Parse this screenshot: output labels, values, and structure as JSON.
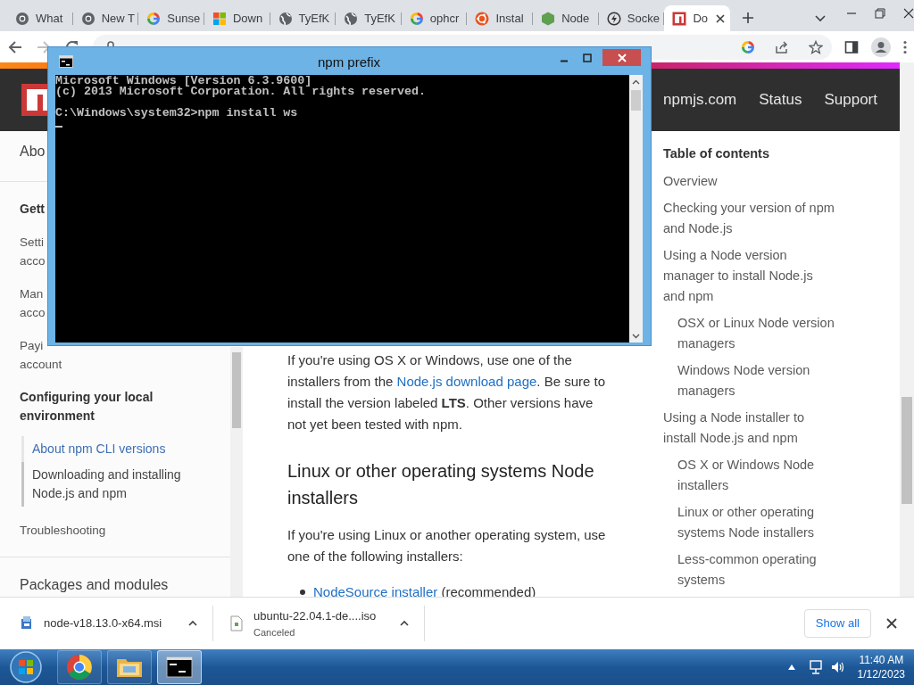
{
  "browser": {
    "tabs": [
      {
        "label": "What",
        "kind": "chrome",
        "selected": false
      },
      {
        "label": "New T",
        "kind": "chrome",
        "selected": false
      },
      {
        "label": "Sunse",
        "kind": "google",
        "selected": false
      },
      {
        "label": "Down",
        "kind": "windows",
        "selected": false
      },
      {
        "label": "TyEfK",
        "kind": "globe",
        "selected": false
      },
      {
        "label": "TyEfK",
        "kind": "globe",
        "selected": false
      },
      {
        "label": "ophcr",
        "kind": "google",
        "selected": false
      },
      {
        "label": "Instal",
        "kind": "ubuntu",
        "selected": false
      },
      {
        "label": "Node",
        "kind": "node",
        "selected": false
      },
      {
        "label": "Socke",
        "kind": "socket",
        "selected": false
      },
      {
        "label": "Do",
        "kind": "npm",
        "selected": true
      }
    ]
  },
  "site_header": {
    "links": [
      "npmjs.com",
      "Status",
      "Support"
    ]
  },
  "sidebar": {
    "items": [
      {
        "kind": "section",
        "lines": [
          "Abo"
        ]
      },
      {
        "kind": "group",
        "lines": [
          "Gett"
        ]
      },
      {
        "kind": "link",
        "lines": [
          "Setti",
          "acco"
        ]
      },
      {
        "kind": "link",
        "lines": [
          "Man",
          "acco"
        ]
      },
      {
        "kind": "link",
        "lines": [
          "Payi",
          "account"
        ]
      },
      {
        "kind": "group",
        "lines": [
          "Configuring your local environment"
        ],
        "children": [
          {
            "label": "About npm CLI versions",
            "selected": false
          },
          {
            "label": "Downloading and installing Node.js and npm",
            "selected": true
          }
        ]
      },
      {
        "kind": "link",
        "lines": [
          "Troubleshooting"
        ]
      },
      {
        "kind": "section",
        "lines": [
          "Packages and modules"
        ]
      }
    ]
  },
  "article": {
    "blocks": [
      {
        "kind": "paragraph",
        "before": "If you're using OS X or Windows, use one of the installers from the ",
        "link": "Node.js download page",
        "after": ". Be sure to install the version labeled **LTS**. Other versions have not yet been tested with npm."
      },
      {
        "kind": "heading",
        "text": "Linux or other operating systems Node installers"
      },
      {
        "kind": "paragraph",
        "before": "If you're using Linux or another operating system, use one of the following installers:"
      },
      {
        "kind": "list",
        "items": [
          {
            "link": "NodeSource installer",
            "after": " (recommended)"
          }
        ]
      }
    ]
  },
  "toc": {
    "title": "Table of contents",
    "items": [
      {
        "label": "Overview"
      },
      {
        "label": "Checking your version of npm and Node.js"
      },
      {
        "label": "Using a Node version manager to install Node.js and npm",
        "children": [
          {
            "label": "OSX or Linux Node version managers"
          },
          {
            "label": "Windows Node version managers"
          }
        ]
      },
      {
        "label": "Using a Node installer to install Node.js and npm",
        "children": [
          {
            "label": "OS X or Windows Node installers"
          },
          {
            "label": "Linux or other operating systems Node installers"
          },
          {
            "label": "Less-common operating systems"
          }
        ]
      }
    ]
  },
  "downloads": {
    "items": [
      {
        "name": "node-v18.13.0-x64.msi",
        "kind": "installer"
      },
      {
        "name": "ubuntu-22.04.1-de....iso",
        "status": "Canceled",
        "kind": "file"
      }
    ],
    "show_all": "Show all"
  },
  "taskbar": {
    "apps": [
      {
        "kind": "chrome",
        "selected": false
      },
      {
        "kind": "explorer",
        "selected": false
      },
      {
        "kind": "cmd",
        "selected": true
      }
    ],
    "time": "11:40 AM",
    "date": "1/12/2023"
  },
  "console": {
    "title": "npm prefix",
    "lines": [
      "Microsoft Windows [Version 6.3.9600]",
      "(c) 2013 Microsoft Corporation. All rights reserved."
    ],
    "prompt": "C:\\Windows\\system32>npm install ws"
  }
}
